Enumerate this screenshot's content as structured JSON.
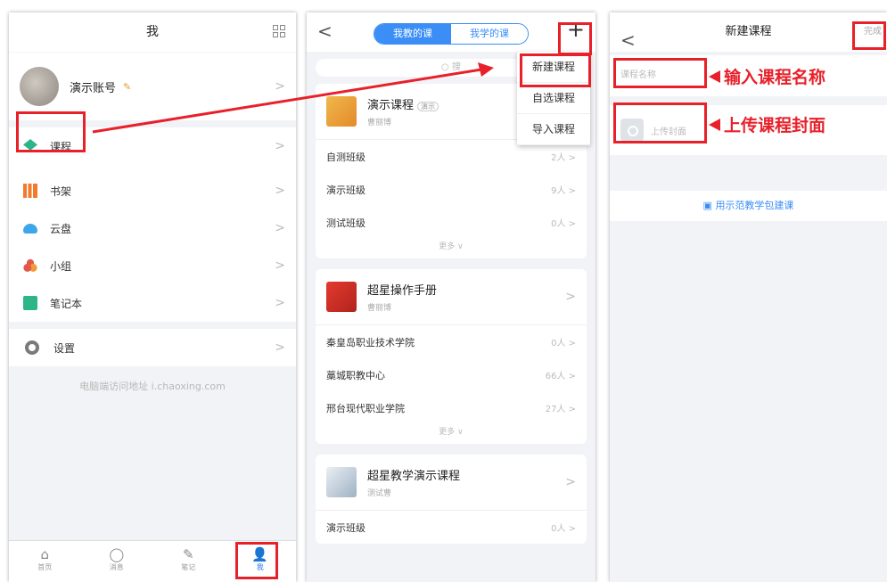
{
  "panel1": {
    "title": "我",
    "profile_name": "演示账号",
    "menu": [
      {
        "label": "课程",
        "icon": "graduation-cap-icon"
      },
      {
        "label": "书架",
        "icon": "bookshelf-icon"
      },
      {
        "label": "云盘",
        "icon": "cloud-icon"
      },
      {
        "label": "小组",
        "icon": "group-icon"
      },
      {
        "label": "笔记本",
        "icon": "notebook-icon"
      }
    ],
    "settings_label": "设置",
    "web_hint": "电脑端访问地址 i.chaoxing.com",
    "tabs": [
      {
        "label": "首页",
        "glyph": "⌂"
      },
      {
        "label": "消息",
        "glyph": "◯"
      },
      {
        "label": "笔记",
        "glyph": "✎"
      },
      {
        "label": "我",
        "glyph": "👤"
      }
    ],
    "chevron": ">"
  },
  "panel2": {
    "back": "<",
    "seg_teach": "我教的课",
    "seg_learn": "我学的课",
    "plus": "+",
    "search_placeholder": "搜",
    "dropdown": [
      "新建课程",
      "自选课程",
      "导入课程"
    ],
    "courses": [
      {
        "title": "演示课程",
        "tag": "演示",
        "teacher": "曹丽博",
        "rows": [
          {
            "name": "自测班级",
            "count": "2人 >"
          },
          {
            "name": "演示班级",
            "count": "9人 >"
          },
          {
            "name": "测试班级",
            "count": "0人 >"
          }
        ],
        "more": "更多 ∨"
      },
      {
        "title": "超星操作手册",
        "teacher": "曹丽博",
        "rows": [
          {
            "name": "秦皇岛职业技术学院",
            "count": "0人 >"
          },
          {
            "name": "藁城职教中心",
            "count": "66人 >"
          },
          {
            "name": "邢台现代职业学院",
            "count": "27人 >"
          }
        ],
        "more": "更多 ∨"
      },
      {
        "title": "超星教学演示课程",
        "teacher": "测试曹",
        "rows": [
          {
            "name": "演示班级",
            "count": "0人 >"
          }
        ]
      }
    ]
  },
  "panel3": {
    "back": "<",
    "title": "新建课程",
    "done": "完成",
    "name_placeholder": "课程名称",
    "cover_label": "上传封面",
    "demo_link": "用示范教学包建课"
  },
  "annotations": {
    "enter_name": "输入课程名称",
    "upload_cover": "上传课程封面"
  },
  "colors": {
    "accent": "#3a8ef6",
    "highlight": "#e8202a",
    "green": "#2db58a"
  }
}
